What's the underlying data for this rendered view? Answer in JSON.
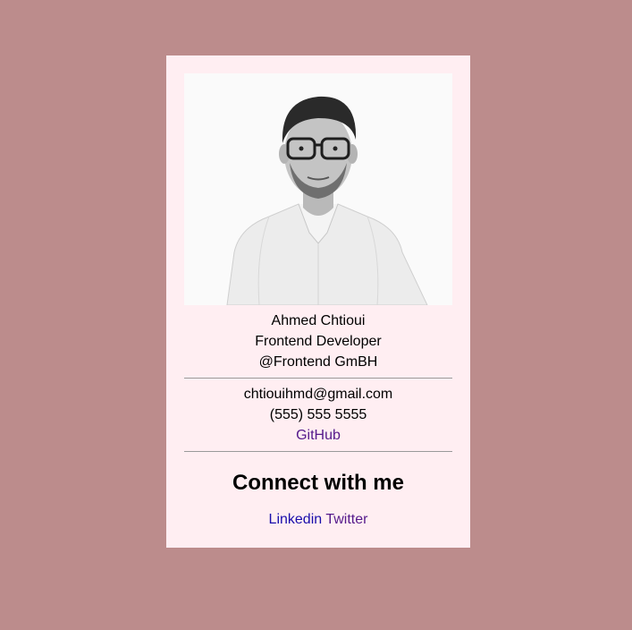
{
  "profile": {
    "photo_alt": "Ahmed Chtioui",
    "name": "Ahmed Chtioui",
    "title": "Frontend Developer",
    "company": "@Frontend GmBH"
  },
  "contact": {
    "email": "chtiouihmd@gmail.com",
    "phone": "(555) 555 5555",
    "github_label": "GitHub"
  },
  "connect": {
    "heading": "Connect with me",
    "linkedin_label": "Linkedin",
    "twitter_label": "Twitter"
  },
  "colors": {
    "page_background": "#bc8c8c",
    "card_background": "#ffeef2",
    "link_visited": "#551a8b",
    "link_unvisited": "#1a0dab"
  }
}
